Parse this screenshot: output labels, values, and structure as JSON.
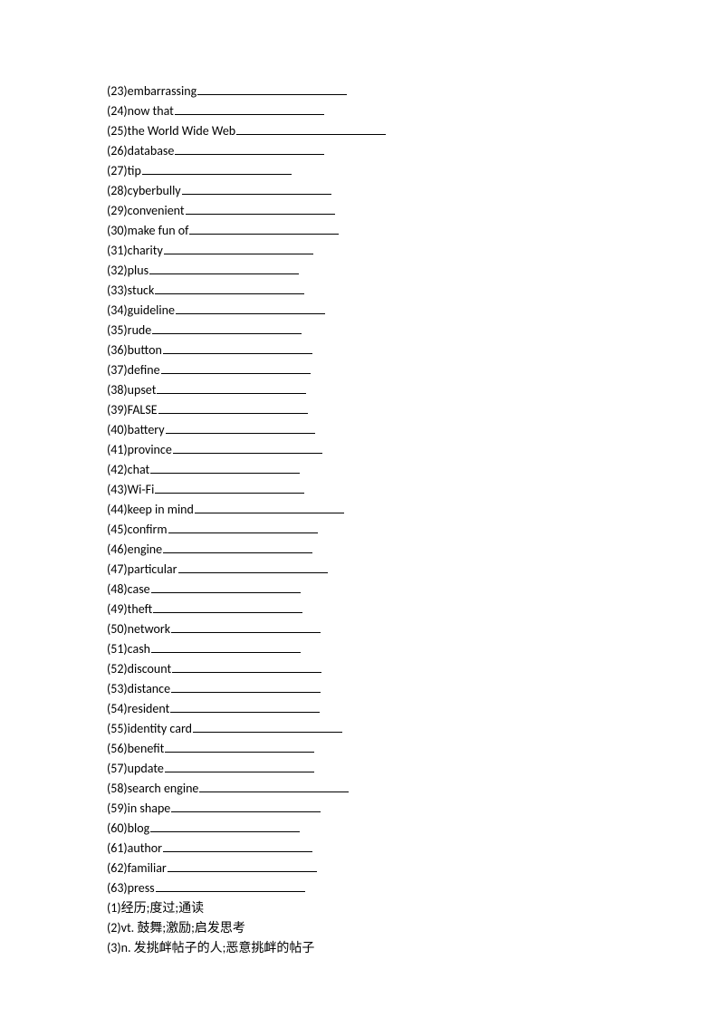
{
  "fill_items": [
    {
      "num": "23",
      "term": "embarrassing",
      "blank_width": 165
    },
    {
      "num": "24",
      "term": "now that",
      "blank_width": 165
    },
    {
      "num": "25",
      "term": "the World Wide Web",
      "blank_width": 165
    },
    {
      "num": "26",
      "term": "database",
      "blank_width": 165
    },
    {
      "num": "27",
      "term": "tip",
      "blank_width": 165
    },
    {
      "num": "28",
      "term": "cyberbully",
      "blank_width": 165
    },
    {
      "num": "29",
      "term": "convenient",
      "blank_width": 165
    },
    {
      "num": "30",
      "term": "make fun of",
      "blank_width": 165
    },
    {
      "num": "31",
      "term": "charity",
      "blank_width": 165
    },
    {
      "num": "32",
      "term": "plus",
      "blank_width": 165
    },
    {
      "num": "33",
      "term": "stuck",
      "blank_width": 165
    },
    {
      "num": "34",
      "term": "guideline",
      "blank_width": 165
    },
    {
      "num": "35",
      "term": "rude",
      "blank_width": 165
    },
    {
      "num": "36",
      "term": "button",
      "blank_width": 165
    },
    {
      "num": "37",
      "term": "define",
      "blank_width": 165
    },
    {
      "num": "38",
      "term": "upset",
      "blank_width": 165
    },
    {
      "num": "39",
      "term": "FALSE",
      "blank_width": 165
    },
    {
      "num": "40",
      "term": "battery",
      "blank_width": 165
    },
    {
      "num": "41",
      "term": "province",
      "blank_width": 165
    },
    {
      "num": "42",
      "term": "chat",
      "blank_width": 165
    },
    {
      "num": "43",
      "term": "Wi-Fi",
      "blank_width": 165
    },
    {
      "num": "44",
      "term": "keep in mind",
      "blank_width": 165
    },
    {
      "num": "45",
      "term": "confirm",
      "blank_width": 165
    },
    {
      "num": "46",
      "term": "engine",
      "blank_width": 165
    },
    {
      "num": "47",
      "term": "particular",
      "blank_width": 165
    },
    {
      "num": "48",
      "term": "case",
      "blank_width": 165
    },
    {
      "num": "49",
      "term": "theft",
      "blank_width": 165
    },
    {
      "num": "50",
      "term": "network",
      "blank_width": 165
    },
    {
      "num": "51",
      "term": "cash",
      "blank_width": 165
    },
    {
      "num": "52",
      "term": "discount",
      "blank_width": 165
    },
    {
      "num": "53",
      "term": "distance",
      "blank_width": 165
    },
    {
      "num": "54",
      "term": "resident",
      "blank_width": 165
    },
    {
      "num": "55",
      "term": "identity card",
      "blank_width": 165
    },
    {
      "num": "56",
      "term": "benefit",
      "blank_width": 165
    },
    {
      "num": "57",
      "term": "update",
      "blank_width": 165
    },
    {
      "num": "58",
      "term": "search engine",
      "blank_width": 165
    },
    {
      "num": "59",
      "term": "in shape",
      "blank_width": 165
    },
    {
      "num": "60",
      "term": "blog",
      "blank_width": 165
    },
    {
      "num": "61",
      "term": "author",
      "blank_width": 165
    },
    {
      "num": "62",
      "term": "familiar",
      "blank_width": 165
    },
    {
      "num": "63",
      "term": "press",
      "blank_width": 165
    }
  ],
  "answer_items": [
    {
      "num": "1",
      "text": "经历;度过;通读"
    },
    {
      "num": "2",
      "text": "vt. 鼓舞;激励;启发思考"
    },
    {
      "num": "3",
      "text": "n. 发挑衅帖子的人;恶意挑衅的帖子"
    }
  ]
}
